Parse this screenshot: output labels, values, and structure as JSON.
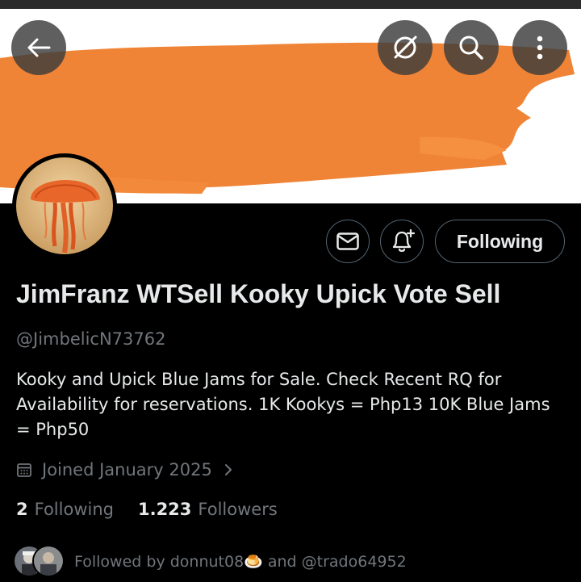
{
  "header": {
    "back_icon": "arrow-left-icon",
    "action_icons": [
      "grok-icon",
      "search-icon",
      "more-vertical-icon"
    ],
    "banner_color": "#f08436"
  },
  "profile": {
    "display_name": "JimFranz WTSell Kooky Upick Vote Sell",
    "handle": "@JimbelicN73762",
    "bio": "Kooky and Upick Blue Jams for Sale. Check Recent RQ for Availability for reservations.  1K Kookys = Php13 10K Blue Jams = Php50",
    "joined": "Joined January 2025",
    "following_count": "2",
    "following_label": "Following",
    "followers_count": "1.223",
    "followers_label": "Followers",
    "followed_by_text": "Followed by donnut08🍮 and @trado64952"
  },
  "actions": {
    "message_icon": "envelope-icon",
    "notify_icon": "bell-plus-icon",
    "follow_button_label": "Following"
  }
}
